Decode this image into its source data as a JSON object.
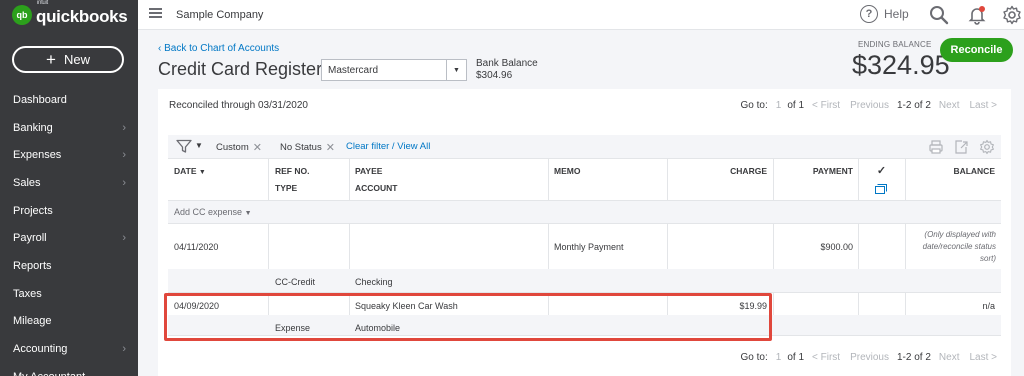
{
  "app": {
    "logo_badge": "qb",
    "logo_sup": "intuit",
    "logo_text": "quickbooks",
    "new_label": "New"
  },
  "sidebar": {
    "items": [
      {
        "label": "Dashboard",
        "chevron": false
      },
      {
        "label": "Banking",
        "chevron": true
      },
      {
        "label": "Expenses",
        "chevron": true
      },
      {
        "label": "Sales",
        "chevron": true
      },
      {
        "label": "Projects",
        "chevron": false
      },
      {
        "label": "Payroll",
        "chevron": true
      },
      {
        "label": "Reports",
        "chevron": false
      },
      {
        "label": "Taxes",
        "chevron": false
      },
      {
        "label": "Mileage",
        "chevron": false
      },
      {
        "label": "Accounting",
        "chevron": true
      },
      {
        "label": "My Accountant",
        "chevron": false
      }
    ]
  },
  "topbar": {
    "company": "Sample Company",
    "help_label": "Help",
    "help_symbol": "?"
  },
  "header": {
    "back_link": "‹ Back to Chart of Accounts",
    "title": "Credit Card Register",
    "account_value": "Mastercard",
    "bank_balance_label": "Bank Balance",
    "bank_balance_value": "$304.96",
    "ending_label": "ENDING BALANCE",
    "ending_value": "$324.95",
    "reconcile_label": "Reconcile"
  },
  "register": {
    "reconciled_through": "Reconciled through 03/31/2020",
    "pager": {
      "goto": "Go to:",
      "page": "1",
      "of": "of 1",
      "first": "< First",
      "previous": "Previous",
      "range": "1-2 of 2",
      "next": "Next",
      "last": "Last >"
    },
    "filters": {
      "chip1": "Custom",
      "chip2": "No Status",
      "clear": "Clear filter / View All"
    },
    "headers": {
      "date": "DATE",
      "ref": "REF NO.",
      "type": "TYPE",
      "payee": "PAYEE",
      "account": "ACCOUNT",
      "memo": "MEMO",
      "charge": "CHARGE",
      "payment": "PAYMENT",
      "check": "✓",
      "balance": "BALANCE"
    },
    "add_row": "Add CC expense",
    "rows": [
      {
        "date": "04/11/2020",
        "ref": "",
        "type": "CC-Credit",
        "payee": "",
        "account": "Checking",
        "memo": "Monthly Payment",
        "charge": "",
        "payment": "$900.00",
        "balance": "(Only displayed with date/reconcile status sort)"
      },
      {
        "date": "04/09/2020",
        "ref": "",
        "type": "Expense",
        "payee": "Squeaky Kleen Car Wash",
        "account": "Automobile",
        "memo": "",
        "charge": "$19.99",
        "payment": "",
        "balance": "n/a"
      }
    ]
  },
  "colors": {
    "sidebar_bg": "#393a3d",
    "accent_green": "#2ca01c",
    "link_blue": "#0077c5",
    "highlight_red": "#e0473c"
  },
  "icons": [
    "hamburger-icon",
    "help-icon",
    "search-icon",
    "bell-icon",
    "gear-icon",
    "filter-icon",
    "print-icon",
    "export-icon",
    "settings-icon",
    "chevron-right-icon",
    "columns-icon"
  ]
}
